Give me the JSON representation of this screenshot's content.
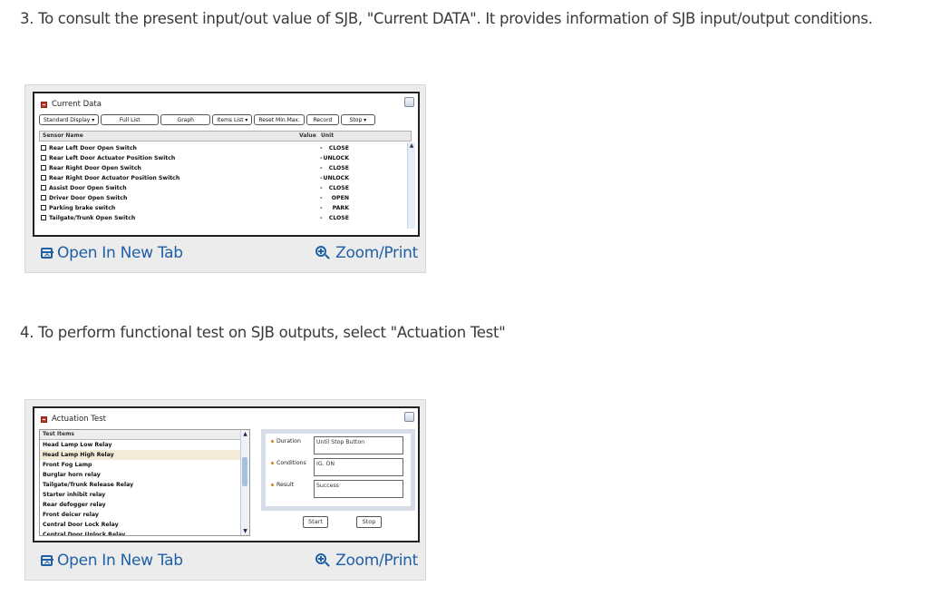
{
  "steps": {
    "step3": "3. To consult the present input/out value of SJB, \"Current DATA\". It provides information of SJB input/output conditions.",
    "step4": "4. To perform functional test on SJB outputs, select \"Actuation Test\""
  },
  "current_data": {
    "title": "Current Data",
    "toolbar": {
      "standard_display": "Standard Display ▾",
      "full_list": "Full List",
      "graph": "Graph",
      "items_list": "Items List ▾",
      "reset_min_max": "Reset Min.Max.",
      "record": "Record",
      "stop": "Stop ▾"
    },
    "columns": {
      "name": "Sensor Name",
      "value": "Value",
      "unit": "Unit"
    },
    "rows": [
      {
        "name": "Rear Left Door Open Switch",
        "value": "CLOSE",
        "unit": "-"
      },
      {
        "name": "Rear Left Door Actuator Position Switch",
        "value": "UNLOCK",
        "unit": "-"
      },
      {
        "name": "Rear Right Door Open Switch",
        "value": "CLOSE",
        "unit": "-"
      },
      {
        "name": "Rear Right Door Actuator Position Switch",
        "value": "UNLOCK",
        "unit": "-"
      },
      {
        "name": "Assist Door Open Switch",
        "value": "CLOSE",
        "unit": "-"
      },
      {
        "name": "Driver Door Open Switch",
        "value": "OPEN",
        "unit": "-"
      },
      {
        "name": "Parking brake switch",
        "value": "PARK",
        "unit": "-"
      },
      {
        "name": "Tailgate/Trunk Open Switch",
        "value": "CLOSE",
        "unit": "-"
      }
    ]
  },
  "actuation_test": {
    "title": "Actuation Test",
    "list_header": "Test Items",
    "items": [
      "Head Lamp Low Relay",
      "Head Lamp High Relay",
      "Front Fog Lamp",
      "Burglar horn relay",
      "Tailgate/Trunk Release Relay",
      "Starter inhibit relay",
      "Rear defogger relay",
      "Front deicer relay",
      "Central Door Lock Relay",
      "Central Door Unlock Relay"
    ],
    "selected_index": 1,
    "duration_label": "Duration",
    "duration_value": "Until Stop Button",
    "conditions_label": "Conditions",
    "conditions_value": "IG. ON",
    "result_label": "Result",
    "result_value": "Success",
    "start_label": "Start",
    "stop_label": "Stop"
  },
  "links": {
    "open_new_tab": "Open In New Tab",
    "zoom_print": "Zoom/Print"
  },
  "colors": {
    "link": "#1f5fa6",
    "accent_dot": "#e07b20",
    "title_icon": "#c23b2a"
  },
  "icons": [
    "open-new-tab-icon",
    "zoom-in-icon",
    "collapse-icon"
  ]
}
